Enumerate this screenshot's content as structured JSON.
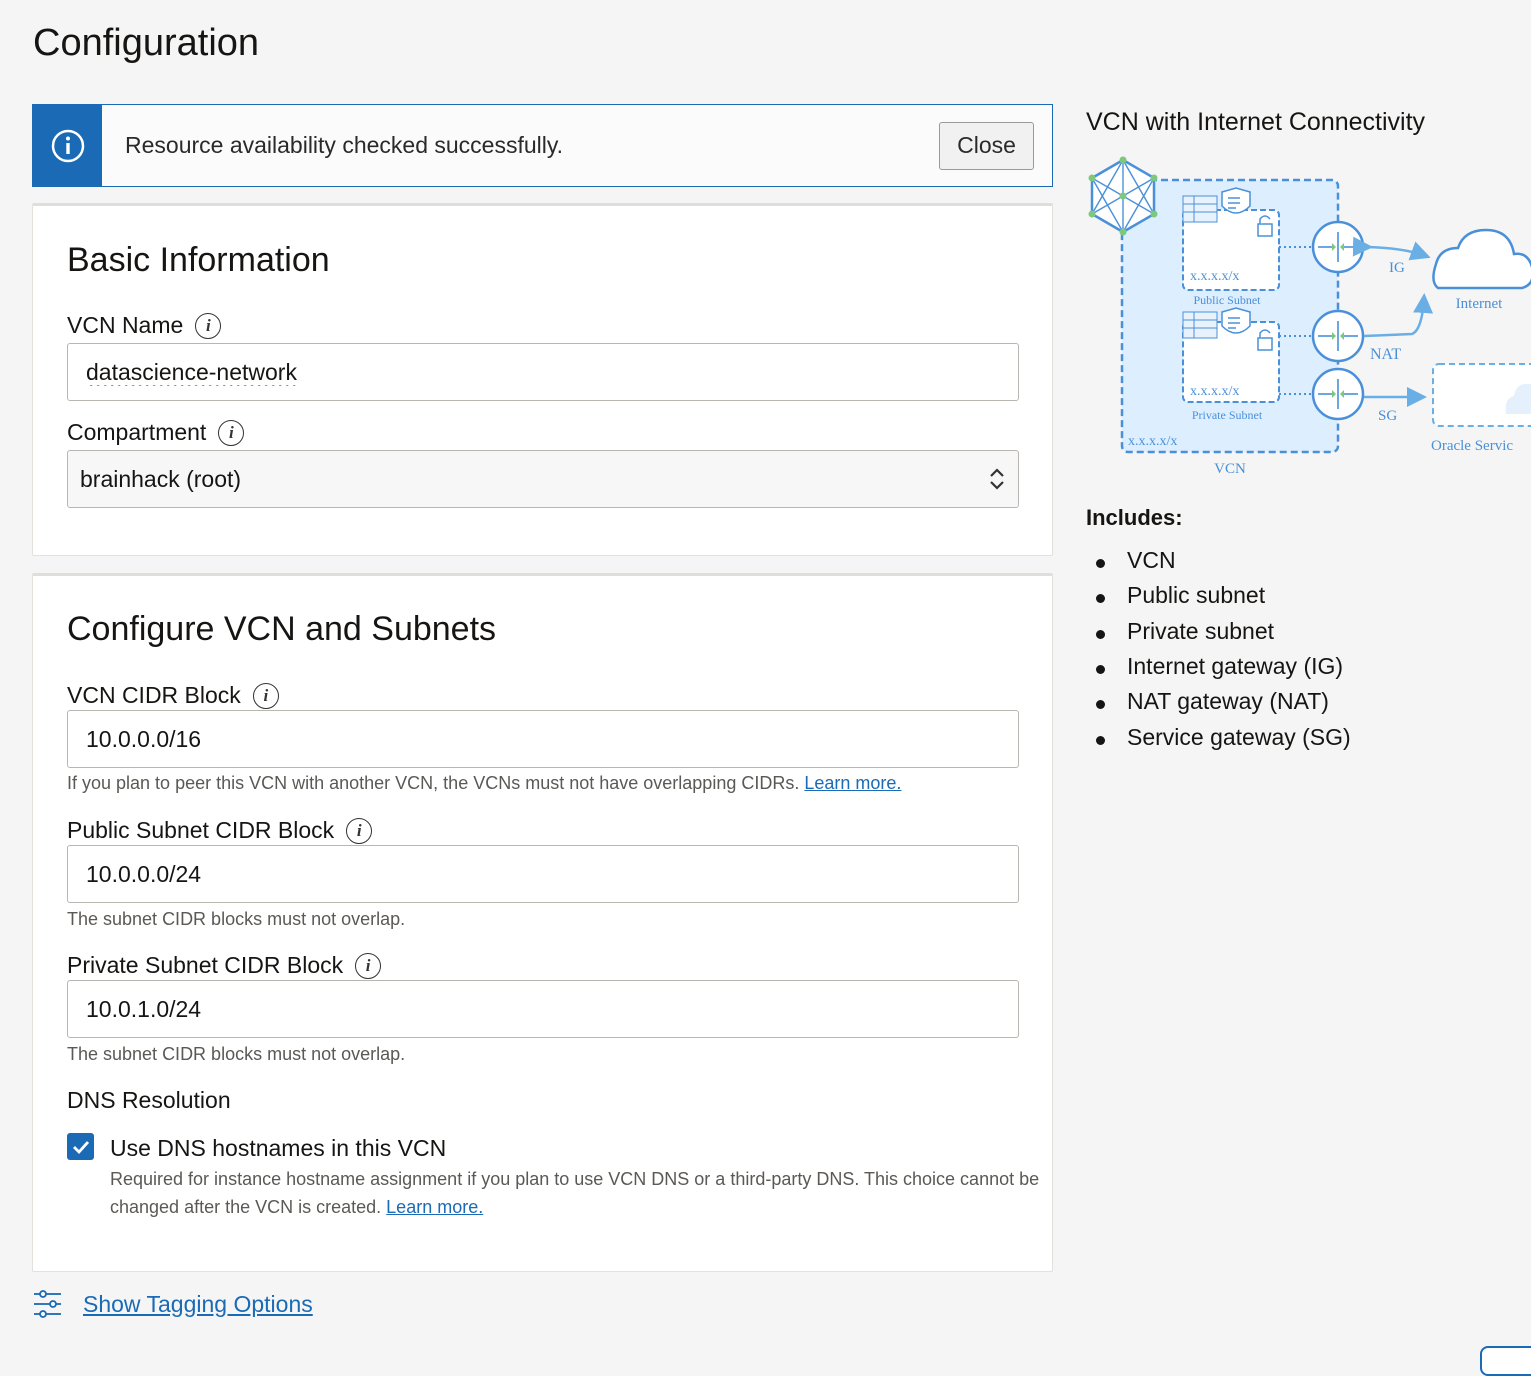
{
  "page": {
    "title": "Configuration"
  },
  "banner": {
    "message": "Resource availability checked successfully.",
    "close_label": "Close"
  },
  "basic_info": {
    "heading": "Basic Information",
    "vcn_name": {
      "label": "VCN Name",
      "value": "datascience-network"
    },
    "compartment": {
      "label": "Compartment",
      "value": "brainhack (root)"
    }
  },
  "vcn_config": {
    "heading": "Configure VCN and Subnets",
    "vcn_cidr": {
      "label": "VCN CIDR Block",
      "value": "10.0.0.0/16",
      "help": "If you plan to peer this VCN with another VCN, the VCNs must not have overlapping CIDRs.",
      "learn_more": "Learn more."
    },
    "public_cidr": {
      "label": "Public Subnet CIDR Block",
      "value": "10.0.0.0/24",
      "help": "The subnet CIDR blocks must not overlap."
    },
    "private_cidr": {
      "label": "Private Subnet CIDR Block",
      "value": "10.0.1.0/24",
      "help": "The subnet CIDR blocks must not overlap."
    },
    "dns": {
      "heading": "DNS Resolution",
      "checkbox_label": "Use DNS hostnames in this VCN",
      "checked": true,
      "description": "Required for instance hostname assignment if you plan to use VCN DNS or a third-party DNS. This choice cannot be changed after the VCN is created.",
      "learn_more": "Learn more."
    }
  },
  "tagging": {
    "label": "Show Tagging Options"
  },
  "diagram": {
    "title": "VCN with Internet Connectivity",
    "labels": {
      "public_cidr": "x.x.x.x/x",
      "public_subnet": "Public Subnet",
      "private_cidr": "x.x.x.x/x",
      "private_subnet": "Private Subnet",
      "vcn_cidr": "x.x.x.x/x",
      "vcn": "VCN",
      "ig": "IG",
      "nat": "NAT",
      "sg": "SG",
      "internet": "Internet",
      "oracle_services": "Oracle Servic"
    },
    "colors": {
      "accent": "#4a90d9",
      "fill": "#ddeeff",
      "node": "#7ec87e"
    }
  },
  "includes": {
    "title": "Includes:",
    "items": [
      "VCN",
      "Public subnet",
      "Private subnet",
      "Internet gateway (IG)",
      "NAT gateway (NAT)",
      "Service gateway (SG)"
    ]
  },
  "colors": {
    "accent": "#1a6ab5",
    "background": "#f5f5f5"
  }
}
